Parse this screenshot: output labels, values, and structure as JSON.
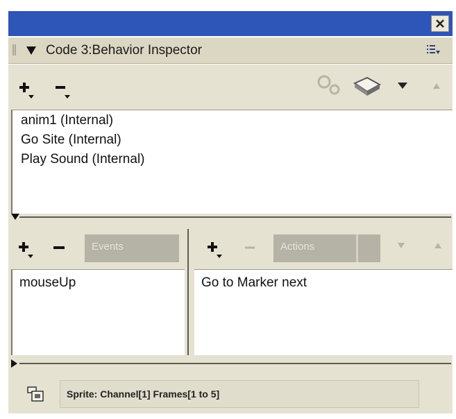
{
  "window": {
    "close_icon": "close-icon"
  },
  "panel": {
    "title": "Code 3:Behavior Inspector",
    "menu_icon": "panel-options-icon"
  },
  "toolbar": {
    "add_behavior_icon": "plus-dropdown-icon",
    "remove_behavior_icon": "minus-dropdown-icon",
    "gear_icon": "gears-icon",
    "script_icon": "script-icon",
    "move_down_icon": "arrow-down-icon",
    "move_up_icon": "arrow-up-icon"
  },
  "behaviors": [
    {
      "label": "anim1 (Internal)"
    },
    {
      "label": "Go Site (Internal)"
    },
    {
      "label": "Play Sound (Internal)"
    }
  ],
  "events": {
    "label": "Events",
    "items": [
      {
        "label": "mouseUp"
      }
    ]
  },
  "actions": {
    "label": "Actions",
    "items": [
      {
        "label": "Go to Marker next"
      }
    ]
  },
  "status": {
    "text": "Sprite:  Channel[1]  Frames[1 to 5]"
  },
  "colors": {
    "titlebar": "#2e55b8",
    "panel_bg": "#e6e2d2",
    "disabled_label_bg": "#b5b2a6"
  }
}
